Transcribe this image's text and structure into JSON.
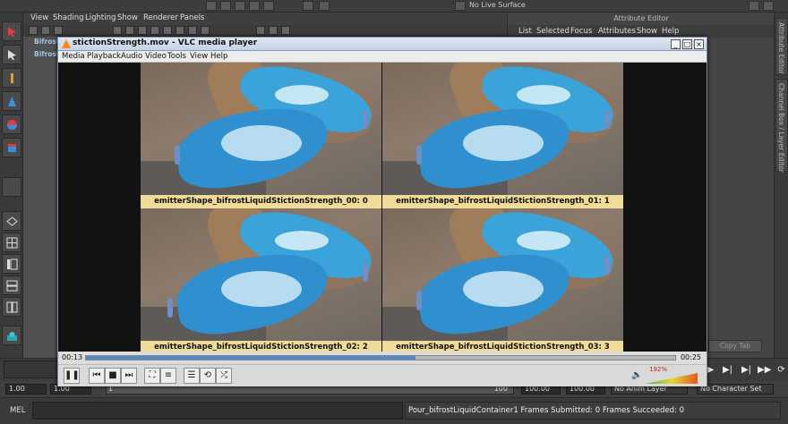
{
  "maya": {
    "no_live_surface": "No Live Surface",
    "panel_menu": [
      "View",
      "Shading",
      "Lighting",
      "Show",
      "Renderer",
      "Panels"
    ],
    "outliner_items": [
      "Bifrost",
      "Bifrost"
    ],
    "attribute_editor": {
      "title": "Attribute Editor",
      "menu": [
        "List",
        "Selected",
        "Focus",
        "Attributes",
        "Show",
        "Help"
      ],
      "copy_tab": "Copy Tab"
    },
    "right_tabs": [
      "Attribute Editor",
      "Channel Box / Layer Editor"
    ],
    "range": {
      "start": "1.00",
      "playback_start": "1.00",
      "marker": "1",
      "end_marker": "100",
      "playback_end": "100.00",
      "end": "100.00",
      "anim_layer": "No Anim Layer",
      "character_set": "No Character Set"
    },
    "command_line": {
      "label": "MEL",
      "output": "Pour_bifrostLiquidContainer1 Frames Submitted: 0 Frames Succeeded: 0"
    }
  },
  "vlc": {
    "title": "stictionStrength.mov - VLC media player",
    "menu": [
      "Media",
      "Playback",
      "Audio",
      "Video",
      "Tools",
      "View",
      "Help"
    ],
    "quadrants": [
      {
        "label": "emitterShape_bifrostLiquidStictionStrength_00: 0"
      },
      {
        "label": "emitterShape_bifrostLiquidStictionStrength_01: 1"
      },
      {
        "label": "emitterShape_bifrostLiquidStictionStrength_02: 2"
      },
      {
        "label": "emitterShape_bifrostLiquidStictionStrength_03: 3"
      }
    ],
    "time_elapsed": "00:13",
    "time_total": "00:25",
    "seek_fraction": 0.56,
    "volume": "192%"
  },
  "colors": {
    "label_bg": "#f0dc98",
    "water": "#3aa3d9",
    "vlc_cone": "#f48b1e"
  }
}
